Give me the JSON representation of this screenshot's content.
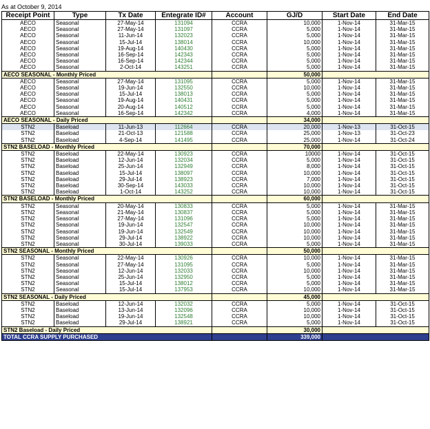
{
  "as_of": "As at October 9, 2014",
  "headers": [
    "Receipt Point",
    "Type",
    "Tx Date",
    "Entegrate ID#",
    "Account",
    "GJ/D",
    "Start Date",
    "End Date"
  ],
  "sections": [
    {
      "rows": [
        {
          "point": "AECO",
          "type": "Seasonal",
          "tx": "27-May-14",
          "id": "131094",
          "account": "CCRA",
          "gj": "10,000",
          "start": "1-Nov-14",
          "end": "31-Mar-15"
        },
        {
          "point": "AECO",
          "type": "Seasonal",
          "tx": "27-May-14",
          "id": "131097",
          "account": "CCRA",
          "gj": "5,000",
          "start": "1-Nov-14",
          "end": "31-Mar-15"
        },
        {
          "point": "AECO",
          "type": "Seasonal",
          "tx": "11-Jun-14",
          "id": "132023",
          "account": "CCRA",
          "gj": "5,000",
          "start": "1-Nov-14",
          "end": "31-Mar-15"
        },
        {
          "point": "AECO",
          "type": "Seasonal",
          "tx": "15-Jul-14",
          "id": "138014",
          "account": "CCRA",
          "gj": "10,000",
          "start": "1-Nov-14",
          "end": "31-Mar-15"
        },
        {
          "point": "AECO",
          "type": "Seasonal",
          "tx": "19-Aug-14",
          "id": "140430",
          "account": "CCRA",
          "gj": "5,000",
          "start": "1-Nov-14",
          "end": "31-Mar-15"
        },
        {
          "point": "AECO",
          "type": "Seasonal",
          "tx": "16-Sep-14",
          "id": "142343",
          "account": "CCRA",
          "gj": "5,000",
          "start": "1-Nov-14",
          "end": "31-Mar-15"
        },
        {
          "point": "AECO",
          "type": "Seasonal",
          "tx": "16-Sep-14",
          "id": "142344",
          "account": "CCRA",
          "gj": "5,000",
          "start": "1-Nov-14",
          "end": "31-Mar-15"
        },
        {
          "point": "AECO",
          "type": "Seasonal",
          "tx": "2-Oct-14",
          "id": "143251",
          "account": "CCRA",
          "gj": "5,000",
          "start": "1-Nov-14",
          "end": "31-Mar-15"
        }
      ],
      "subtotal": {
        "label": "AECO SEASONAL - Monthly Priced",
        "value": "50,000"
      }
    },
    {
      "rows": [
        {
          "point": "AECO",
          "type": "Seasonal",
          "tx": "27-May-14",
          "id": "131095",
          "account": "CCRA",
          "gj": "5,000",
          "start": "1-Nov-14",
          "end": "31-Mar-15"
        },
        {
          "point": "AECO",
          "type": "Seasonal",
          "tx": "19-Jun-14",
          "id": "132550",
          "account": "CCRA",
          "gj": "10,000",
          "start": "1-Nov-14",
          "end": "31-Mar-15"
        },
        {
          "point": "AECO",
          "type": "Seasonal",
          "tx": "15-Jul-14",
          "id": "138013",
          "account": "CCRA",
          "gj": "5,000",
          "start": "1-Nov-14",
          "end": "31-Mar-15"
        },
        {
          "point": "AECO",
          "type": "Seasonal",
          "tx": "19-Aug-14",
          "id": "140431",
          "account": "CCRA",
          "gj": "5,000",
          "start": "1-Nov-14",
          "end": "31-Mar-15"
        },
        {
          "point": "AECO",
          "type": "Seasonal",
          "tx": "20-Aug-14",
          "id": "140512",
          "account": "CCRA",
          "gj": "5,000",
          "start": "1-Nov-14",
          "end": "31-Mar-15"
        },
        {
          "point": "AECO",
          "type": "Seasonal",
          "tx": "16-Sep-14",
          "id": "142342",
          "account": "CCRA",
          "gj": "4,000",
          "start": "1-Nov-14",
          "end": "31-Mar-15"
        }
      ],
      "subtotal": {
        "label": "AECO SEASONAL - Daily Priced",
        "value": "34,000"
      }
    },
    {
      "rows": [
        {
          "point": "STN2",
          "type": "Baseload",
          "tx": "11-Jun-13",
          "id": "112664",
          "account": "CCRA",
          "gj": "20,000",
          "start": "1-Nov-13",
          "end": "31-Oct-15",
          "highlight": true
        },
        {
          "point": "STN2",
          "type": "Baseload",
          "tx": "21-Oct-13",
          "id": "121588",
          "account": "CCRA",
          "gj": "25,000",
          "start": "1-Nov-13",
          "end": "31-Oct-23"
        },
        {
          "point": "STN2",
          "type": "Baseload",
          "tx": "4-Sep-14",
          "id": "141495",
          "account": "CCRA",
          "gj": "25,000",
          "start": "1-Nov-14",
          "end": "31-Oct-24"
        }
      ],
      "subtotal": {
        "label": "STN2 BASELOAD - Monthly Priced",
        "value": "70,000"
      }
    },
    {
      "rows": [
        {
          "point": "STN2",
          "type": "Baseload",
          "tx": "22-May-14",
          "id": "130923",
          "account": "CCRA",
          "gj": "10000",
          "start": "1-Nov-14",
          "end": "31-Oct-15"
        },
        {
          "point": "STN2",
          "type": "Baseload",
          "tx": "12-Jun-14",
          "id": "132034",
          "account": "CCRA",
          "gj": "5,000",
          "start": "1-Nov-14",
          "end": "31-Oct-15"
        },
        {
          "point": "STN2",
          "type": "Baseload",
          "tx": "25-Jun-14",
          "id": "132949",
          "account": "CCRA",
          "gj": "8,000",
          "start": "1-Nov-14",
          "end": "31-Oct-15"
        },
        {
          "point": "STN2",
          "type": "Baseload",
          "tx": "15-Jul-14",
          "id": "138097",
          "account": "CCRA",
          "gj": "10,000",
          "start": "1-Nov-14",
          "end": "31-Oct-15"
        },
        {
          "point": "STN2",
          "type": "Baseload",
          "tx": "29-Jul-14",
          "id": "138923",
          "account": "CCRA",
          "gj": "7,000",
          "start": "1-Nov-14",
          "end": "31-Oct-15"
        },
        {
          "point": "STN2",
          "type": "Baseload",
          "tx": "30-Sep-14",
          "id": "143033",
          "account": "CCRA",
          "gj": "10,000",
          "start": "1-Nov-14",
          "end": "31-Oct-15"
        },
        {
          "point": "STN2",
          "type": "Baseload",
          "tx": "1-Oct-14",
          "id": "143252",
          "account": "CCRA",
          "gj": "10,000",
          "start": "1-Nov-14",
          "end": "31-Oct-15"
        }
      ],
      "subtotal": {
        "label": "STN2 BASELOAD - Monthly Priced",
        "value": "60,000"
      }
    },
    {
      "rows": [
        {
          "point": "STN2",
          "type": "Seasonal",
          "tx": "20-May-14",
          "id": "130833",
          "account": "CCRA",
          "gj": "5,000",
          "start": "1-Nov-14",
          "end": "31-Mar-15"
        },
        {
          "point": "STN2",
          "type": "Seasonal",
          "tx": "21-May-14",
          "id": "130837",
          "account": "CCRA",
          "gj": "5,000",
          "start": "1-Nov-14",
          "end": "31-Mar-15"
        },
        {
          "point": "STN2",
          "type": "Seasonal",
          "tx": "27-May-14",
          "id": "131096",
          "account": "CCRA",
          "gj": "5,000",
          "start": "1-Nov-14",
          "end": "31-Mar-15"
        },
        {
          "point": "STN2",
          "type": "Seasonal",
          "tx": "19-Jun-14",
          "id": "132547",
          "account": "CCRA",
          "gj": "10,000",
          "start": "1-Nov-14",
          "end": "31-Mar-15"
        },
        {
          "point": "STN2",
          "type": "Seasonal",
          "tx": "19-Jun-14",
          "id": "132549",
          "account": "CCRA",
          "gj": "10,000",
          "start": "1-Nov-14",
          "end": "31-Mar-15"
        },
        {
          "point": "STN2",
          "type": "Seasonal",
          "tx": "29-Jul-14",
          "id": "138922",
          "account": "CCRA",
          "gj": "10,000",
          "start": "1-Nov-14",
          "end": "31-Mar-15"
        },
        {
          "point": "STN2",
          "type": "Seasonal",
          "tx": "30-Jul-14",
          "id": "139033",
          "account": "CCRA",
          "gj": "5,000",
          "start": "1-Nov-14",
          "end": "31-Mar-15"
        }
      ],
      "subtotal": {
        "label": "STN2 SEASONAL - Monthly Priced",
        "value": "50,000"
      }
    },
    {
      "rows": [
        {
          "point": "STN2",
          "type": "Seasonal",
          "tx": "22-May-14",
          "id": "130926",
          "account": "CCRA",
          "gj": "10,000",
          "start": "1-Nov-14",
          "end": "31-Mar-15"
        },
        {
          "point": "STN2",
          "type": "Seasonal",
          "tx": "27-May-14",
          "id": "131095",
          "account": "CCRA",
          "gj": "5,000",
          "start": "1-Nov-14",
          "end": "31-Mar-15"
        },
        {
          "point": "STN2",
          "type": "Seasonal",
          "tx": "12-Jun-14",
          "id": "132033",
          "account": "CCRA",
          "gj": "10,000",
          "start": "1-Nov-14",
          "end": "31-Mar-15"
        },
        {
          "point": "STN2",
          "type": "Seasonal",
          "tx": "25-Jun-14",
          "id": "132950",
          "account": "CCRA",
          "gj": "5,000",
          "start": "1-Nov-14",
          "end": "31-Mar-15"
        },
        {
          "point": "STN2",
          "type": "Seasonal",
          "tx": "15-Jul-14",
          "id": "138012",
          "account": "CCRA",
          "gj": "5,000",
          "start": "1-Nov-14",
          "end": "31-Mar-15"
        },
        {
          "point": "STN2",
          "type": "Seasonal",
          "tx": "15-Jul-14",
          "id": "137953",
          "account": "CCRA",
          "gj": "10,000",
          "start": "1-Nov-14",
          "end": "31-Mar-15"
        }
      ],
      "subtotal": {
        "label": "STN2 SEASONAL - Daily Priced",
        "value": "45,000"
      }
    },
    {
      "rows": [
        {
          "point": "STN2",
          "type": "Baseload",
          "tx": "12-Jun-14",
          "id": "132032",
          "account": "CCRA",
          "gj": "5,000",
          "start": "1-Nov-14",
          "end": "31-Oct-15"
        },
        {
          "point": "STN2",
          "type": "Baseload",
          "tx": "13-Jun-14",
          "id": "132096",
          "account": "CCRA",
          "gj": "10,000",
          "start": "1-Nov-14",
          "end": "31-Oct-15"
        },
        {
          "point": "STN2",
          "type": "Baseload",
          "tx": "19-Jun-14",
          "id": "132548",
          "account": "CCRA",
          "gj": "10,000",
          "start": "1-Nov-14",
          "end": "31-Oct-15"
        },
        {
          "point": "STN2",
          "type": "Baseload",
          "tx": "29-Jul-14",
          "id": "138921",
          "account": "CCRA",
          "gj": "5,000",
          "start": "1-Nov-14",
          "end": "31-Oct-15"
        }
      ],
      "subtotal": {
        "label": "STN2 Baseload - Daily Priced",
        "value": "30,000"
      }
    }
  ],
  "total": {
    "label": "TOTAL CCRA SUPPLY PURCHASED",
    "value": "339,000"
  },
  "colors": {
    "id_text": "#2e7d32",
    "subtotal_bg": "#fffcd6",
    "total_bg": "#2f3f8f",
    "highlight_row": "#dde4ef"
  }
}
